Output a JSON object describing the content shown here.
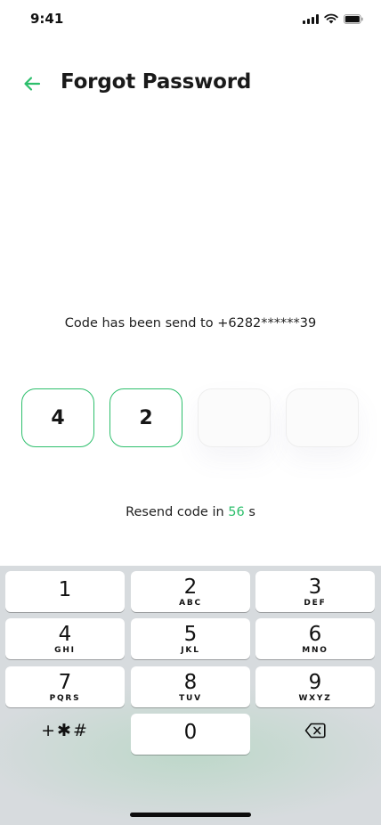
{
  "status_bar": {
    "time": "9:41"
  },
  "header": {
    "title": "Forgot Password"
  },
  "message": {
    "text": "Code has been send to +6282******39"
  },
  "code": {
    "digits": [
      "4",
      "2",
      "",
      ""
    ]
  },
  "resend": {
    "prefix": "Resend code in ",
    "seconds": "56",
    "suffix": " s"
  },
  "keypad": {
    "keys": [
      {
        "digit": "1",
        "letters": ""
      },
      {
        "digit": "2",
        "letters": "ABC"
      },
      {
        "digit": "3",
        "letters": "DEF"
      },
      {
        "digit": "4",
        "letters": "GHI"
      },
      {
        "digit": "5",
        "letters": "JKL"
      },
      {
        "digit": "6",
        "letters": "MNO"
      },
      {
        "digit": "7",
        "letters": "PQRS"
      },
      {
        "digit": "8",
        "letters": "TUV"
      },
      {
        "digit": "9",
        "letters": "WXYZ"
      },
      {
        "digit": "0",
        "letters": ""
      }
    ],
    "symbols_label": "+✱#"
  },
  "colors": {
    "accent": "#2dbf6c",
    "keyboard_bg": "#d7dbde"
  }
}
